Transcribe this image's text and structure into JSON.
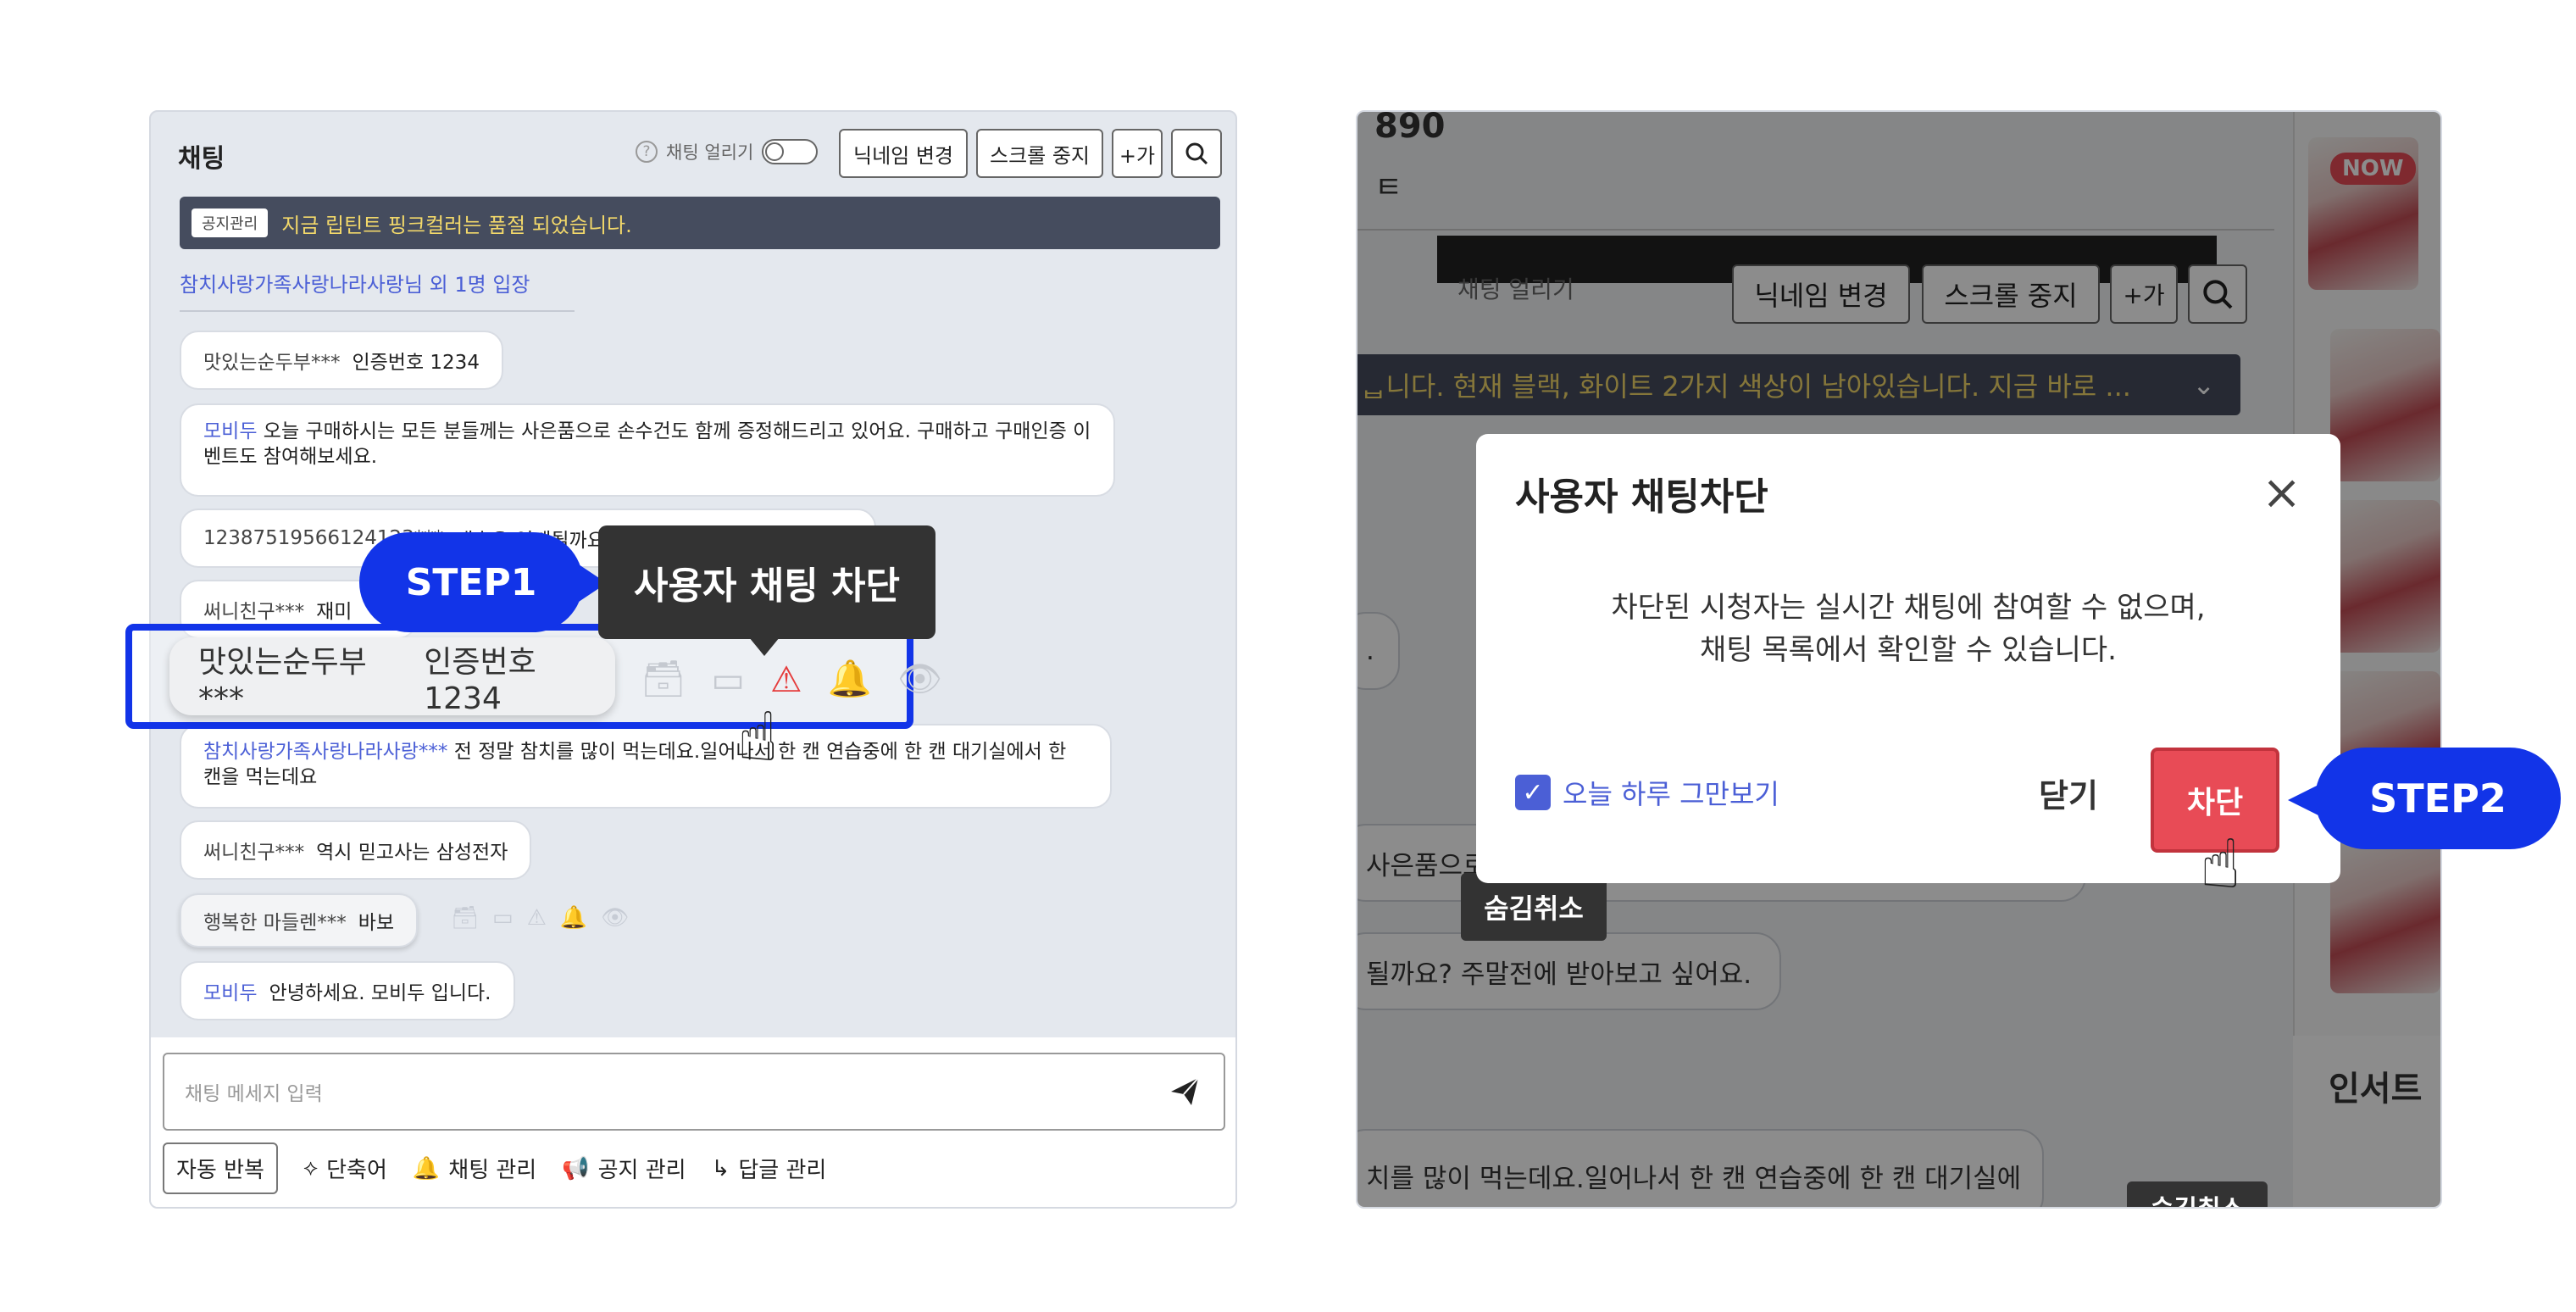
{
  "left": {
    "title": "채팅",
    "toggle_label": "채팅 얼리기",
    "buttons": [
      "닉네임 변경",
      "스크롤 중지",
      "+가"
    ],
    "notice": {
      "tag": "공지관리",
      "text": "지금 립틴트 핑크컬러는 품절 되었습니다."
    },
    "enter_text": "참치사랑가족사랑나라사랑님 외 1명 입장",
    "messages": [
      {
        "nick": "맛있는순두부***",
        "text": "인증번호 1234"
      },
      {
        "nick": "모비두",
        "text": "오늘 구매하시는 모든 분들께는 사은품으로 손수건도 함께 증정해드리고 있어요. 구매하고 구매인증 이벤트도 참여해보세요."
      },
      {
        "nick": "12387519566124123***",
        "text": "배송은 언제될까요? 주말전에 받아보고 싶어요."
      },
      {
        "nick": "써니친구***",
        "text": "재미"
      },
      {
        "nick": "참치사랑가족사랑나라사랑***",
        "text": "전 정말 참치를 많이 먹는데요.일어나서 한 캔 연습중에 한 캔 대기실에서 한 캔을 먹는데요"
      },
      {
        "nick": "써니친구***",
        "text": "역시 믿고사는 삼성전자"
      },
      {
        "nick": "행복한 마들렌***",
        "text": "바보"
      },
      {
        "nick": "모비두",
        "text": "안녕하세요. 모비두 입니다."
      }
    ],
    "highlight": {
      "nick": "맛있는순두부***",
      "text": "인증번호 1234"
    },
    "input_placeholder": "채팅 메세지 입력",
    "tools": [
      "자동 반복",
      "단축어",
      "채팅 관리",
      "공지 관리",
      "답글 관리"
    ],
    "step1_label": "STEP1",
    "step1_tooltip": "사용자 채팅 차단"
  },
  "right": {
    "bg": {
      "top_num": "890",
      "top_letter": "ㅌ",
      "toggle_label": "채팅 얼리기",
      "btn1": "닉네임 변경",
      "btn2": "스크롤 중지",
      "btn3": "+가",
      "notice": "ᆸ니다. 현재 블랙, 화이트 2가지 색상이 남아있습니다. 지금 바로 ...",
      "now_badge": "NOW",
      "dot": ".",
      "gift": "사은품으로",
      "hide_tooltip": "숨김취소",
      "delivery": "될까요? 주말전에 받아보고 싶어요.",
      "insert": "인서트",
      "tuna": "치를 많이 먹는데요.일어나서 한 캔 연습중에 한 캔 대기실에",
      "hide_tooltip2": "숨김취소"
    },
    "modal": {
      "title": "사용자 채팅차단",
      "body_line1": "차단된 시청자는 실시간 채팅에 참여할 수 없으며,",
      "body_line2": "채팅 목록에서 확인할 수 있습니다.",
      "check_label": "오늘 하루 그만보기",
      "close_label": "닫기",
      "block_label": "차단"
    },
    "step2_label": "STEP2"
  },
  "colors": {
    "accent": "#1234e8",
    "danger": "#e84b56",
    "link": "#4b5fd6",
    "notice_bg": "#454c5e",
    "notice_text": "#f2d86a"
  }
}
